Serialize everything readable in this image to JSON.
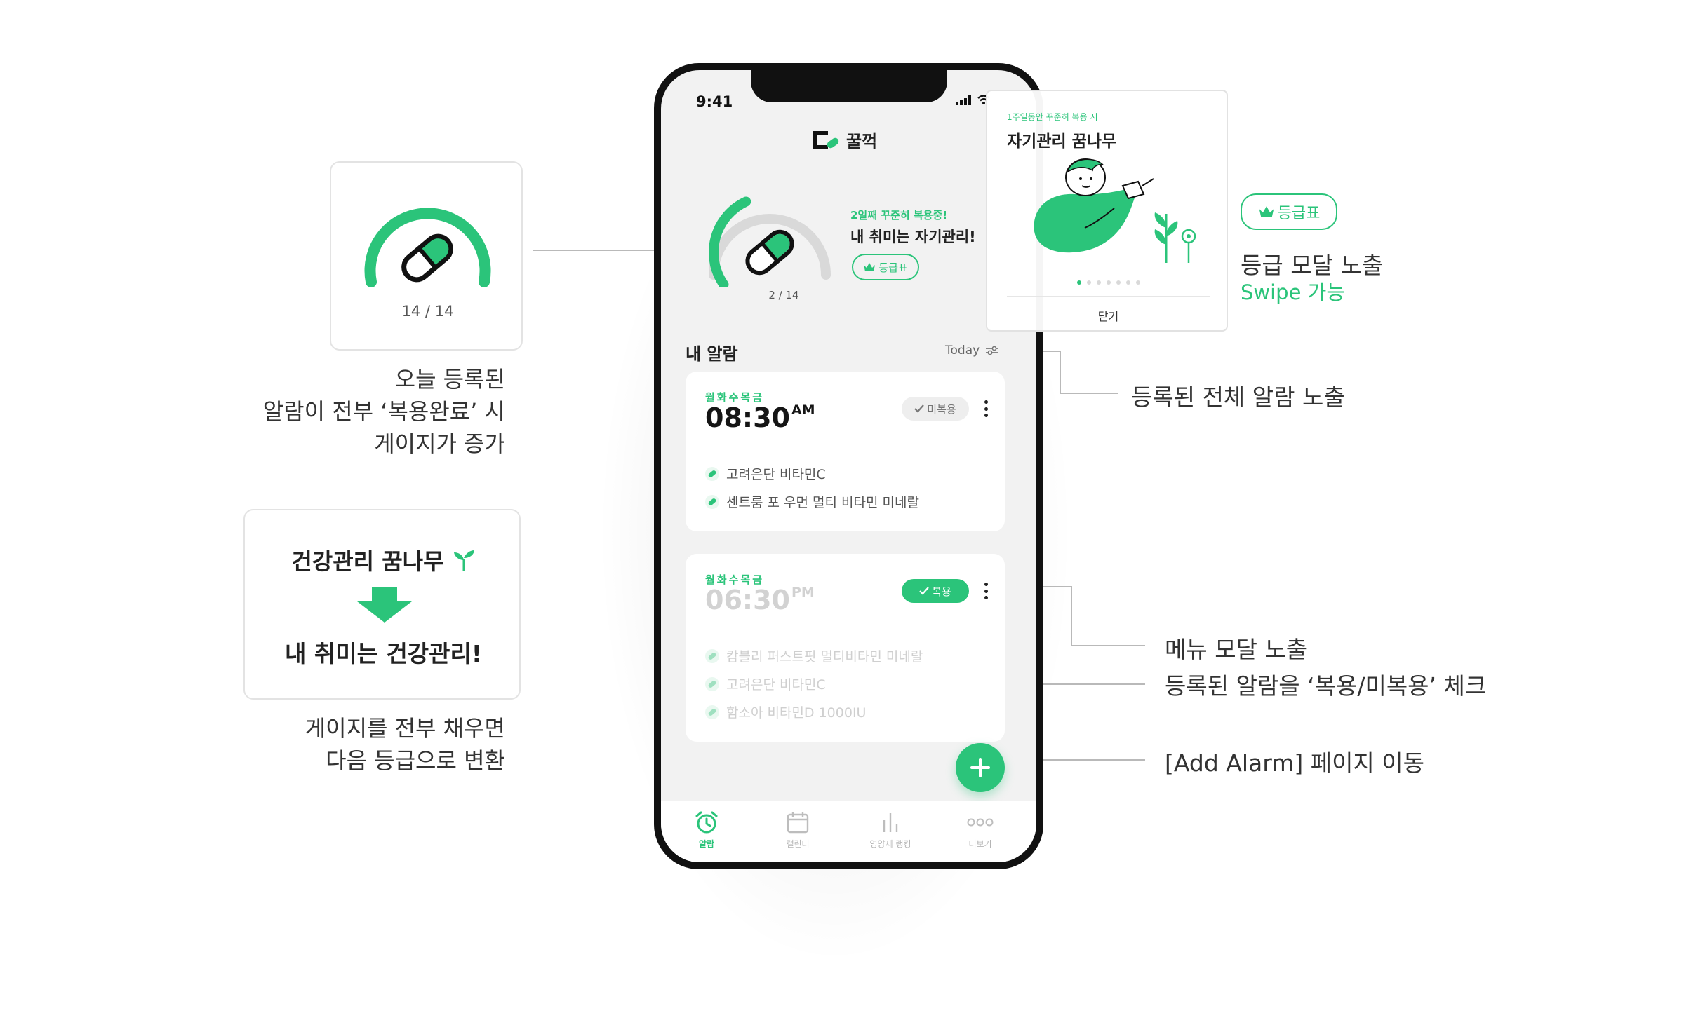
{
  "colors": {
    "accent": "#2bc47a",
    "text": "#2b2b2b",
    "muted": "#b5b5b5"
  },
  "gauge_card": {
    "label": "14 / 14",
    "fill": 1.0
  },
  "gauge_note": [
    "오늘 등록된",
    "알람이 전부 ‘복용완료’ 시",
    "게이지가 증가"
  ],
  "grade_card": {
    "before": "건강관리 꿈나무",
    "after": "내 취미는 건강관리!",
    "sprout_icon": "sprout-icon",
    "arrow_icon": "down-arrow-icon"
  },
  "grade_note": [
    "게이지를 전부 채우면",
    "다음 등급으로 변환"
  ],
  "phone": {
    "status_time": "9:41",
    "brand": "꿀꺽",
    "gauge_label": "2 / 14",
    "gauge_fill": 0.4,
    "streak_small": "2일째 꾸준히 복용중!",
    "streak_title": "내 취미는 자기관리!",
    "grade_button": "등급표",
    "section_title": "내 알람",
    "filter_label": "Today",
    "alarms": [
      {
        "days": "월화수목금",
        "time": "08:30",
        "ampm": "AM",
        "status": "미복용",
        "taken": false,
        "meds": [
          "고려은단 비타민C",
          "센트룸 포 우먼 멀티 비타민 미네랄"
        ]
      },
      {
        "days": "월화수목금",
        "time": "06:30",
        "ampm": "PM",
        "status": "복용",
        "taken": true,
        "meds": [
          "캄블리 퍼스트핏 멀티비타민 미네랄",
          "고려은단 비타민C",
          "함소아 비타민D 1000IU"
        ]
      }
    ],
    "tabs": [
      {
        "label": "알람",
        "icon": "alarm-clock-icon",
        "active": true
      },
      {
        "label": "캘린더",
        "icon": "calendar-icon",
        "active": false
      },
      {
        "label": "영양제 랭킹",
        "icon": "bar-chart-icon",
        "active": false
      },
      {
        "label": "더보기",
        "icon": "more-icon",
        "active": false
      }
    ]
  },
  "modal": {
    "small": "1주일동안 꾸준히 복용 시",
    "title": "자기관리 꿈나무",
    "page_count": 7,
    "active_page": 0,
    "close": "닫기"
  },
  "right_notes": {
    "grade_button": "등급표",
    "modal_note": "등급 모달 노출",
    "swipe_note": "Swipe 가능",
    "all_alarms": "등록된 전체 알람 노출",
    "menu_modal": "메뉴 모달 노출",
    "check_note": "등록된 알람을 ‘복용/미복용’ 체크",
    "add_alarm": "[Add Alarm] 페이지 이동"
  }
}
